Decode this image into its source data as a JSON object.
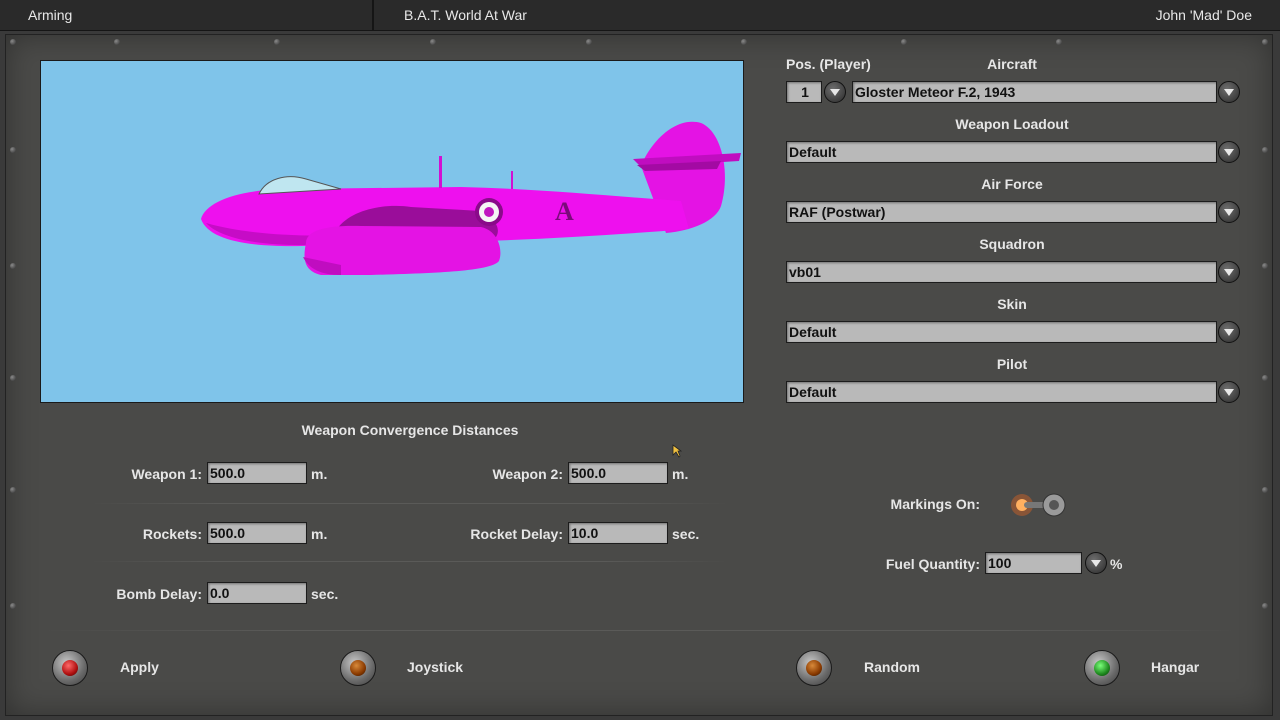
{
  "titlebar": {
    "section": "Arming",
    "app_title": "B.A.T. World At War",
    "user": "John 'Mad' Doe"
  },
  "aircraft_panel": {
    "pos_label": "Pos. (Player)",
    "aircraft_label": "Aircraft",
    "pos_value": "1",
    "aircraft_value": "Gloster Meteor F.2, 1943",
    "loadout_label": "Weapon Loadout",
    "loadout_value": "Default",
    "airforce_label": "Air Force",
    "airforce_value": "RAF (Postwar)",
    "squadron_label": "Squadron",
    "squadron_value": "vb01",
    "skin_label": "Skin",
    "skin_value": "Default",
    "pilot_label": "Pilot",
    "pilot_value": "Default"
  },
  "preview": {
    "fuselage_code": "A",
    "sky_color": "#7fc4ea",
    "aircraft_color": "#ee10ee"
  },
  "convergence": {
    "heading": "Weapon Convergence Distances",
    "weapon1_label": "Weapon 1:",
    "weapon1_value": "500.0",
    "weapon1_unit": "m.",
    "weapon2_label": "Weapon 2:",
    "weapon2_value": "500.0",
    "weapon2_unit": "m.",
    "rockets_label": "Rockets:",
    "rockets_value": "500.0",
    "rockets_unit": "m.",
    "rocket_delay_label": "Rocket Delay:",
    "rocket_delay_value": "10.0",
    "rocket_delay_unit": "sec.",
    "bomb_delay_label": "Bomb Delay:",
    "bomb_delay_value": "0.0",
    "bomb_delay_unit": "sec."
  },
  "options": {
    "markings_label": "Markings On:",
    "markings_on": true,
    "fuel_label": "Fuel Quantity:",
    "fuel_value": "100",
    "fuel_unit": "%"
  },
  "buttons": {
    "apply": "Apply",
    "joystick": "Joystick",
    "random": "Random",
    "hangar": "Hangar"
  },
  "lamp_colors": {
    "apply": "#b01010",
    "joystick": "#8a3a00",
    "random": "#8a3a00",
    "hangar": "#1f8a1f"
  }
}
